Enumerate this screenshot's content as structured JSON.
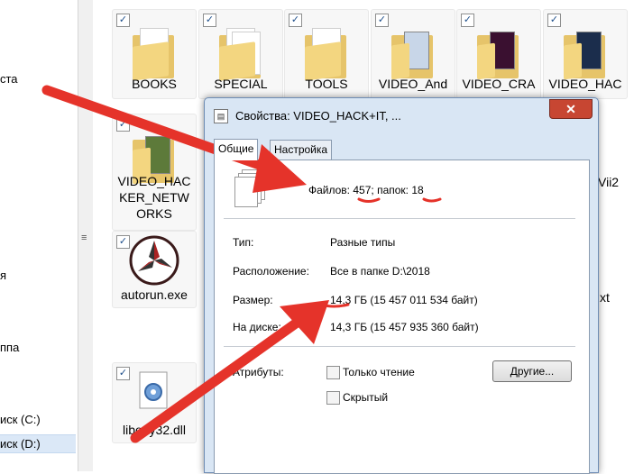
{
  "nav": {
    "items": [
      "ста",
      "я",
      "ппа",
      "иск (C:)",
      "иск (D:)"
    ]
  },
  "files": {
    "row1": [
      "BOOKS",
      "SPECIAL",
      "TOOLS",
      "VIDEO_And",
      "VIDEO_CRA",
      "VIDEO_HAC"
    ],
    "row2": [
      "VIDEO_HAC",
      "KER_NETW",
      "ORKS"
    ],
    "autorun": "autorun.exe",
    "libeay": "libeay32.dll",
    "right_side_1": "Vii2",
    "right_side_2": "xt"
  },
  "dialog": {
    "title": "Свойства: VIDEO_HACK+IT, ...",
    "close_glyph": "✕",
    "tabs": [
      "Общие",
      "Настройка"
    ],
    "counts": {
      "files_label": "Файлов:",
      "files_value": "457",
      "folders_label": "; папок:",
      "folders_value": "18"
    },
    "type": {
      "label": "Тип:",
      "value": "Разные типы"
    },
    "location": {
      "label": "Расположение:",
      "value": "Все в папке D:\\2018"
    },
    "size": {
      "label": "Размер:",
      "value": "14,3 ГБ (15 457 011 534 байт)"
    },
    "on_disk": {
      "label": "На диске:",
      "value": "14,3 ГБ (15 457 935 360 байт)"
    },
    "attributes": {
      "label": "Атрибуты:",
      "readonly": "Только чтение",
      "hidden": "Скрытый",
      "other_button": "Другие..."
    }
  },
  "colors": {
    "arrow": "#e5332a",
    "dialog_frame": "#d9e6f4",
    "close_button": "#c74632",
    "folder": "#e6c46a"
  }
}
